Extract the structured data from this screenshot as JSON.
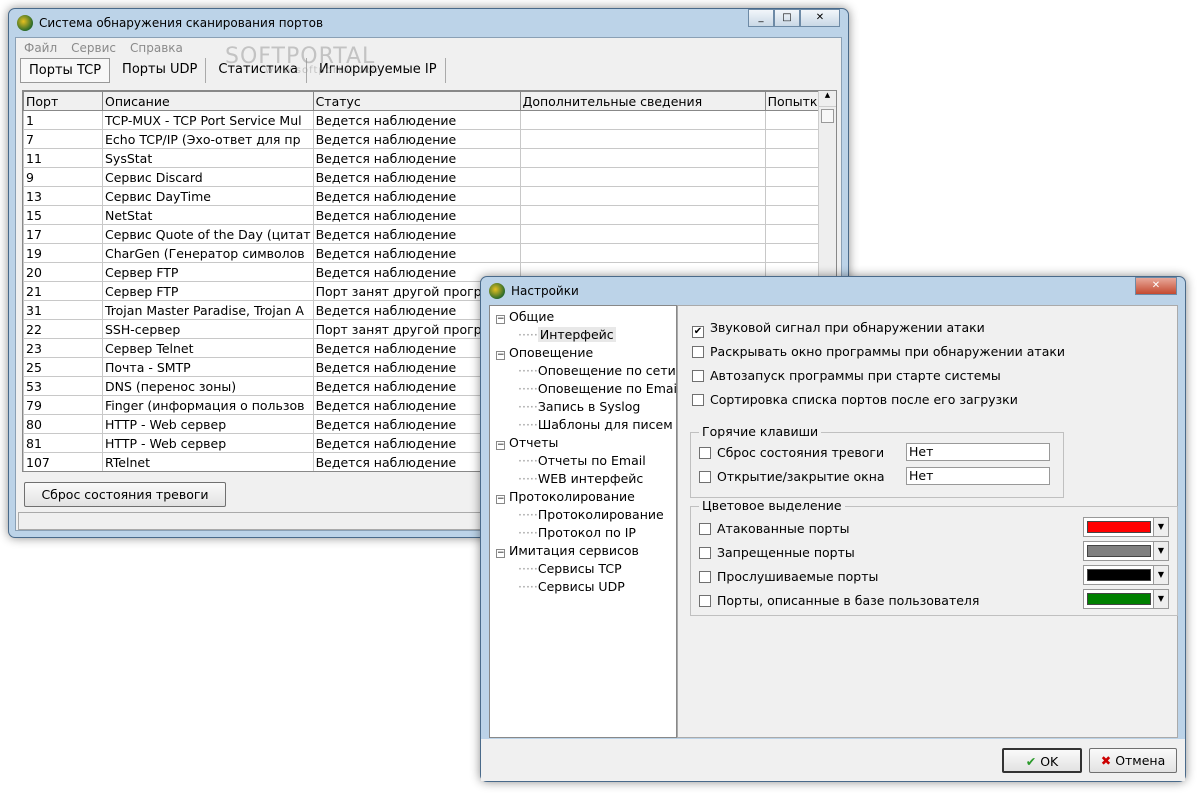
{
  "main": {
    "title": "Система обнаружения сканирования портов",
    "menu": [
      "Файл",
      "Сервис",
      "Справка"
    ],
    "tabs": [
      "Порты TCP",
      "Порты UDP",
      "Статистика",
      "Игнорируемые IP"
    ],
    "columns": [
      "Порт",
      "Описание",
      "Статус",
      "Дополнительные сведения",
      "Попытка"
    ],
    "rows": [
      [
        "1",
        "TCP-MUX - TCP Port Service Mul",
        "Ведется наблюдение"
      ],
      [
        "7",
        "Echo TCP/IP (Эхо-ответ для пр",
        "Ведется наблюдение"
      ],
      [
        "11",
        "SysStat",
        "Ведется наблюдение"
      ],
      [
        "9",
        "Сервис Discard",
        "Ведется наблюдение"
      ],
      [
        "13",
        "Сервис DayTime",
        "Ведется наблюдение"
      ],
      [
        "15",
        "NetStat",
        "Ведется наблюдение"
      ],
      [
        "17",
        "Сервис Quote of the Day (цитат",
        "Ведется наблюдение"
      ],
      [
        "19",
        "CharGen (Генератор символов",
        "Ведется наблюдение"
      ],
      [
        "20",
        "Сервер FTP",
        "Ведется наблюдение"
      ],
      [
        "21",
        "Сервер FTP",
        "Порт занят другой програм"
      ],
      [
        "31",
        "Trojan Master Paradise, Trojan A",
        "Ведется наблюдение"
      ],
      [
        "22",
        "SSH-сервер",
        "Порт занят другой програм"
      ],
      [
        "23",
        "Сервер Telnet",
        "Ведется наблюдение"
      ],
      [
        "25",
        "Почта - SMTP",
        "Ведется наблюдение"
      ],
      [
        "53",
        "DNS (перенос зоны)",
        "Ведется наблюдение"
      ],
      [
        "79",
        "Finger (информация о пользов",
        "Ведется наблюдение"
      ],
      [
        "80",
        "HTTP - Web сервер",
        "Ведется наблюдение"
      ],
      [
        "81",
        "HTTP - Web сервер",
        "Ведется наблюдение"
      ],
      [
        "107",
        "RTelnet",
        "Ведется наблюдение"
      ]
    ],
    "reset_button": "Сброс состояния тревоги"
  },
  "dialog": {
    "title": "Настройки",
    "tree": [
      {
        "label": "Общие",
        "level": 0
      },
      {
        "label": "Интерфейс",
        "level": 1,
        "selected": true
      },
      {
        "label": "Оповещение",
        "level": 0
      },
      {
        "label": "Оповещение по сети",
        "level": 1
      },
      {
        "label": "Оповещение по Email",
        "level": 1
      },
      {
        "label": "Запись в Syslog",
        "level": 1
      },
      {
        "label": "Шаблоны для писем",
        "level": 1
      },
      {
        "label": "Отчеты",
        "level": 0
      },
      {
        "label": "Отчеты по Email",
        "level": 1
      },
      {
        "label": "WEB интерфейс",
        "level": 1
      },
      {
        "label": "Протоколирование",
        "level": 0
      },
      {
        "label": "Протоколирование",
        "level": 1
      },
      {
        "label": "Протокол по IP",
        "level": 1
      },
      {
        "label": "Имитация сервисов",
        "level": 0
      },
      {
        "label": "Сервисы TCP",
        "level": 1
      },
      {
        "label": "Сервисы UDP",
        "level": 1
      }
    ],
    "options": [
      {
        "label": "Звуковой сигнал при обнаружении атаки",
        "checked": true
      },
      {
        "label": "Раскрывать окно программы при обнаружении атаки",
        "checked": false
      },
      {
        "label": "Автозапуск программы при старте системы",
        "checked": false
      },
      {
        "label": "Сортировка списка портов после его загрузки",
        "checked": false
      }
    ],
    "hotkeys": {
      "title": "Горячие клавиши",
      "items": [
        {
          "label": "Сброс состояния тревоги",
          "value": "Нет"
        },
        {
          "label": "Открытие/закрытие окна",
          "value": "Нет"
        }
      ]
    },
    "colors": {
      "title": "Цветовое выделение",
      "items": [
        {
          "label": "Атакованные порты",
          "color": "#ff0000"
        },
        {
          "label": "Запрещенные порты",
          "color": "#808080"
        },
        {
          "label": "Прослушиваемые порты",
          "color": "#000000"
        },
        {
          "label": "Порты, описанные в базе пользователя",
          "color": "#008000"
        }
      ]
    },
    "ok": "OK",
    "cancel": "Отмена"
  },
  "watermark": {
    "text": "SOFTPORTAL",
    "url": "www.softportal.com"
  }
}
